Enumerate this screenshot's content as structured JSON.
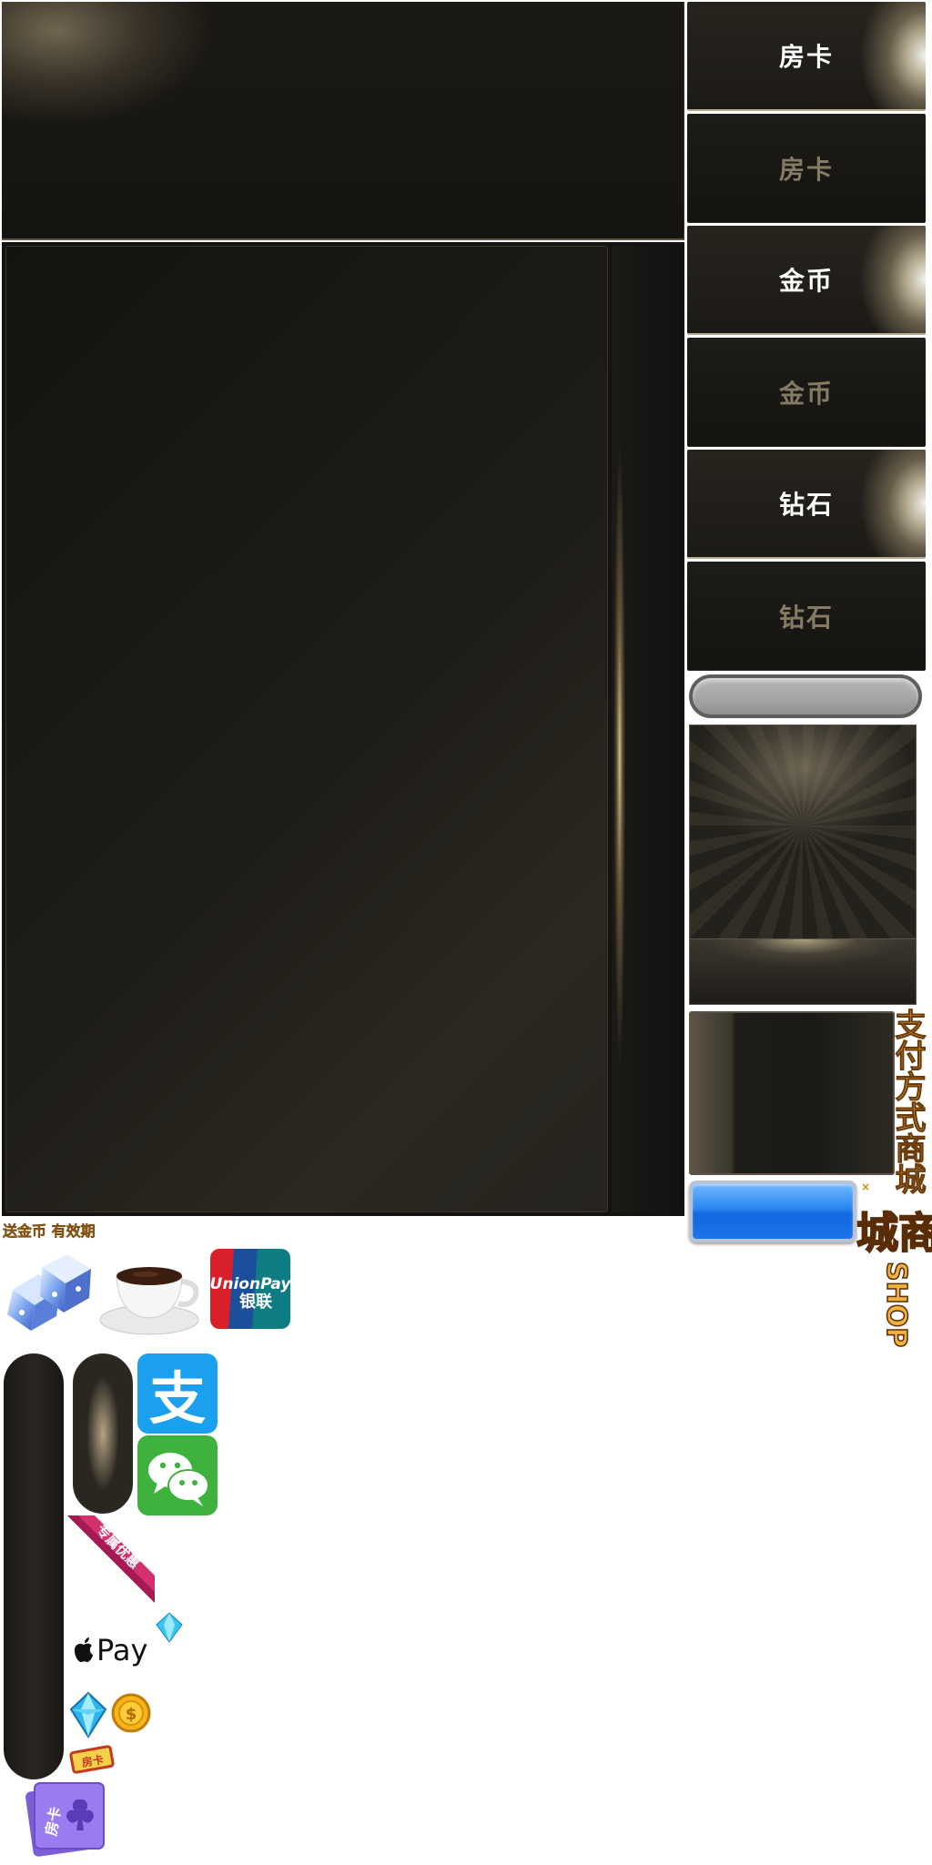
{
  "tabs": [
    {
      "label": "房卡",
      "state": "active"
    },
    {
      "label": "房卡",
      "state": "inactive"
    },
    {
      "label": "金币",
      "state": "active"
    },
    {
      "label": "金币",
      "state": "inactive"
    },
    {
      "label": "钻石",
      "state": "active"
    },
    {
      "label": "钻石",
      "state": "inactive"
    }
  ],
  "labels": {
    "gold_validity": "送金币 有效期",
    "vertical_title": "支付方式商城",
    "small_mark": "×",
    "shop_logo_cn": "商城",
    "shop_logo_en": "SHOP",
    "alipay_glyph": "支",
    "unionpay_en": "UnionPay",
    "unionpay_cn": "银联",
    "ribbon_text": "专属优惠",
    "apple_pay": "Pay",
    "fangka_small": "房卡",
    "fangka_card": "房卡"
  },
  "colors": {
    "accent_gold": "#e8a22c",
    "panel_dark": "#141311",
    "tab_active_text": "#ffffff",
    "tab_inactive_text": "#857a63",
    "alipay_blue": "#1aa0ee",
    "wechat_green": "#3fb23d",
    "button_blue": "#1c73ea"
  }
}
